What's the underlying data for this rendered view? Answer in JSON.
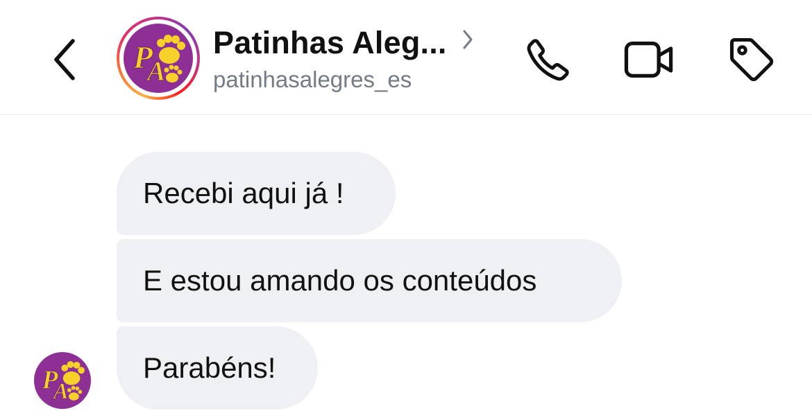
{
  "header": {
    "back_icon": "chevron-left-icon",
    "title": "Patinhas Aleg...",
    "title_chevron_icon": "chevron-right-icon",
    "username": "patinhasalegres_es",
    "actions": {
      "call_icon": "phone-icon",
      "video_icon": "video-camera-icon",
      "tag_icon": "tag-icon"
    }
  },
  "profile": {
    "logo_letters": "PA",
    "ring_colors": [
      "#fcaf45",
      "#f77737",
      "#e1306c",
      "#c13584",
      "#833ab4"
    ],
    "logo_bg": "#8e2f96",
    "logo_fg": "#f7d12a"
  },
  "messages": [
    {
      "text": "Recebi aqui já !"
    },
    {
      "text": "E estou amando os conteúdos"
    },
    {
      "text": "Parabéns!"
    }
  ],
  "colors": {
    "bubble_bg": "#eff0f3",
    "text": "#111111",
    "muted": "#737b86",
    "divider": "#ececec"
  }
}
